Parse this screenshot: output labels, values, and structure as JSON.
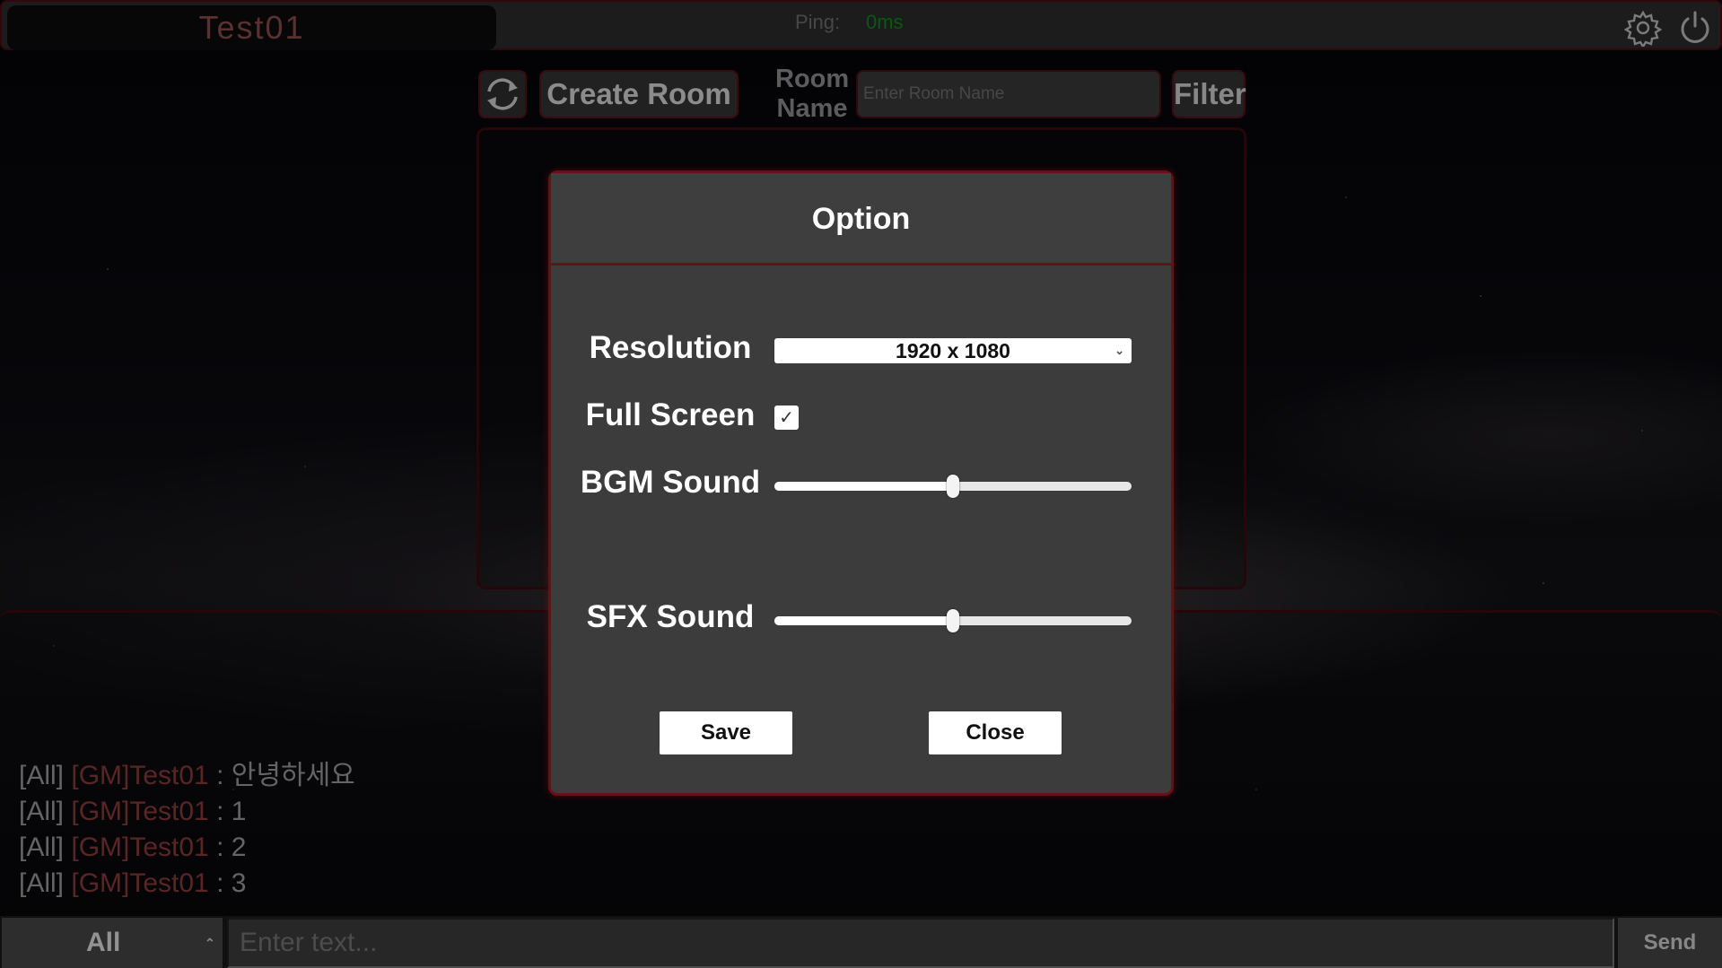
{
  "topbar": {
    "player_name": "Test01",
    "ping_label": "Ping:",
    "ping_value": "0ms"
  },
  "icons": {
    "settings": "gear-icon",
    "power": "power-icon",
    "refresh": "refresh-icon"
  },
  "lobby": {
    "create_room_label": "Create Room",
    "room_name_label": "Room Name",
    "room_name_placeholder": "Enter Room Name",
    "room_name_value": "",
    "filter_label": "Filter"
  },
  "options_modal": {
    "title": "Option",
    "resolution_label": "Resolution",
    "resolution_value": "1920 x 1080",
    "fullscreen_label": "Full Screen",
    "fullscreen_checked": true,
    "bgm_label": "BGM Sound",
    "bgm_level": 0.5,
    "sfx_label": "SFX Sound",
    "sfx_level": 0.5,
    "save_label": "Save",
    "close_label": "Close"
  },
  "chat": {
    "messages": [
      {
        "channel": "[All]",
        "sender": "[GM]Test01",
        "text": ": 안녕하세요"
      },
      {
        "channel": "[All]",
        "sender": "[GM]Test01",
        "text": ": 1"
      },
      {
        "channel": "[All]",
        "sender": "[GM]Test01",
        "text": ": 2"
      },
      {
        "channel": "[All]",
        "sender": "[GM]Test01",
        "text": ": 3"
      }
    ],
    "channel_value": "All",
    "input_placeholder": "Enter text...",
    "send_label": "Send"
  },
  "colors": {
    "accent_red": "#6a0f17",
    "sender_color": "#8b3a3a",
    "ping_color": "#0c8a1c"
  }
}
